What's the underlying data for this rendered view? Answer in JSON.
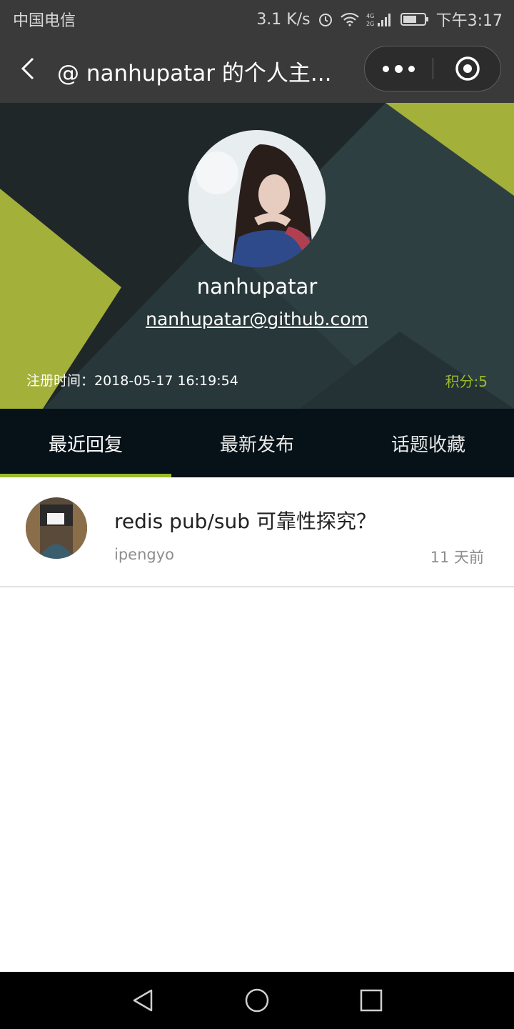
{
  "status_bar": {
    "carrier": "中国电信",
    "speed": "3.1 K/s",
    "time": "下午3:17",
    "icons": [
      "alarm-icon",
      "wifi-icon",
      "signal-icon",
      "battery-icon"
    ]
  },
  "nav": {
    "title": "@ nanhupatar 的个人主...",
    "icons": [
      "back-icon",
      "more-icon",
      "close-target-icon"
    ]
  },
  "profile": {
    "username": "nanhupatar",
    "email": "nanhupatar@github.com",
    "register_time": "注册时间：2018-05-17 16:19:54",
    "points": "积分:5"
  },
  "tabs": [
    {
      "label": "最近回复",
      "active": true
    },
    {
      "label": "最新发布",
      "active": false
    },
    {
      "label": "话题收藏",
      "active": false
    }
  ],
  "replies": [
    {
      "title": "redis pub/sub 可靠性探究？",
      "author": "ipengyo",
      "time": "11 天前"
    }
  ],
  "colors": {
    "accent": "#9bbb2a",
    "header_bg": "#3a3a3a",
    "tab_bg": "#061218"
  }
}
